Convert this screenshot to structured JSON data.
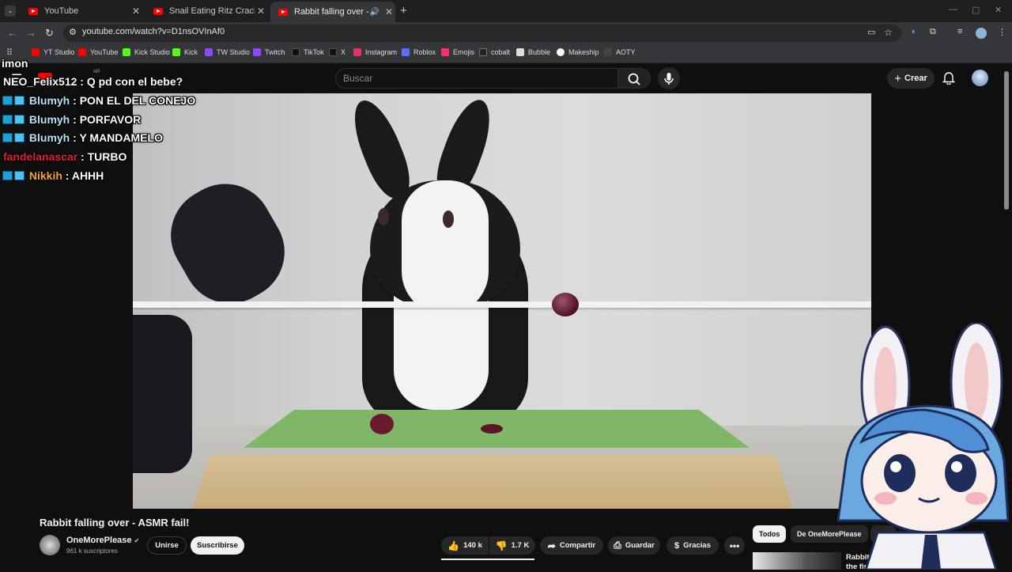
{
  "browser": {
    "tabs": [
      {
        "title": "YouTube",
        "active": false
      },
      {
        "title": "Snail Eating Ritz Cracker But Th",
        "active": false
      },
      {
        "title": "Rabbit falling over - ASMR",
        "active": true
      }
    ],
    "new_tab": "+",
    "url": "youtube.com/watch?v=D1nsOVInAf0",
    "bookmarks": [
      {
        "label": "YT Studio",
        "icon": "youtube-icon",
        "color": "#ff0000"
      },
      {
        "label": "YouTube",
        "icon": "youtube-icon",
        "color": "#ff0000"
      },
      {
        "label": "Kick Studio",
        "icon": "kick-icon",
        "color": "#53fc18"
      },
      {
        "label": "Kick",
        "icon": "kick-icon",
        "color": "#53fc18"
      },
      {
        "label": "TW Studio",
        "icon": "twitch-icon",
        "color": "#9146ff"
      },
      {
        "label": "Twitch",
        "icon": "twitch-icon",
        "color": "#9146ff"
      },
      {
        "label": "TikTok",
        "icon": "tiktok-icon",
        "color": "#111111"
      },
      {
        "label": "X",
        "icon": "x-icon",
        "color": "#111111"
      },
      {
        "label": "Instagram",
        "icon": "instagram-icon",
        "color": "#e1306c"
      },
      {
        "label": "Roblox",
        "icon": "roblox-icon",
        "color": "#5b6cff"
      },
      {
        "label": "Emojis",
        "icon": "emoji-icon",
        "color": "#ff2f6d"
      },
      {
        "label": "cobalt",
        "icon": "cobalt-icon",
        "color": "#222222"
      },
      {
        "label": "Bubble",
        "icon": "bubble-icon",
        "color": "#dddddd"
      },
      {
        "label": "Makeship",
        "icon": "makeship-icon",
        "color": "#ffffff"
      },
      {
        "label": "AOTY",
        "icon": "aoty-icon",
        "color": "#444444"
      }
    ]
  },
  "youtube": {
    "search_placeholder": "Buscar",
    "create_label": "Crear",
    "logo_region": "AR",
    "video_title": "Rabbit falling over - ASMR fail!",
    "channel_name": "OneMorePlease",
    "subscribers": "961 k suscriptores",
    "join_label": "Unirse",
    "subscribe_label": "Suscribirse",
    "likes": "140 k",
    "dislikes": "1.7 K",
    "share_label": "Compartir",
    "save_label": "Guardar",
    "thanks_label": "Gracias",
    "chips": [
      "Todos",
      "De OneMorePlease",
      "Cor"
    ],
    "related_title": "Rabbit sees himself for the first time"
  },
  "chat": {
    "partial_top": "imon",
    "messages": [
      {
        "user": "NEO_Felix512",
        "text": "Q pd con el bebe?",
        "color": "#ffffff",
        "badge": false
      },
      {
        "user": "Blumyh",
        "text": "PON EL DEL CONEJO",
        "color": "#b9e3f5",
        "badge": true
      },
      {
        "user": "Blumyh",
        "text": "PORFAVOR",
        "color": "#b9e3f5",
        "badge": true
      },
      {
        "user": "Blumyh",
        "text": "Y MANDAMELO",
        "color": "#b9e3f5",
        "badge": true
      },
      {
        "user": "fandelanascar",
        "text": "TURBO",
        "color": "#e0203a",
        "badge": false
      },
      {
        "user": "Nikkih",
        "text": "AHHH",
        "color": "#f5a623",
        "badge": true
      }
    ]
  }
}
